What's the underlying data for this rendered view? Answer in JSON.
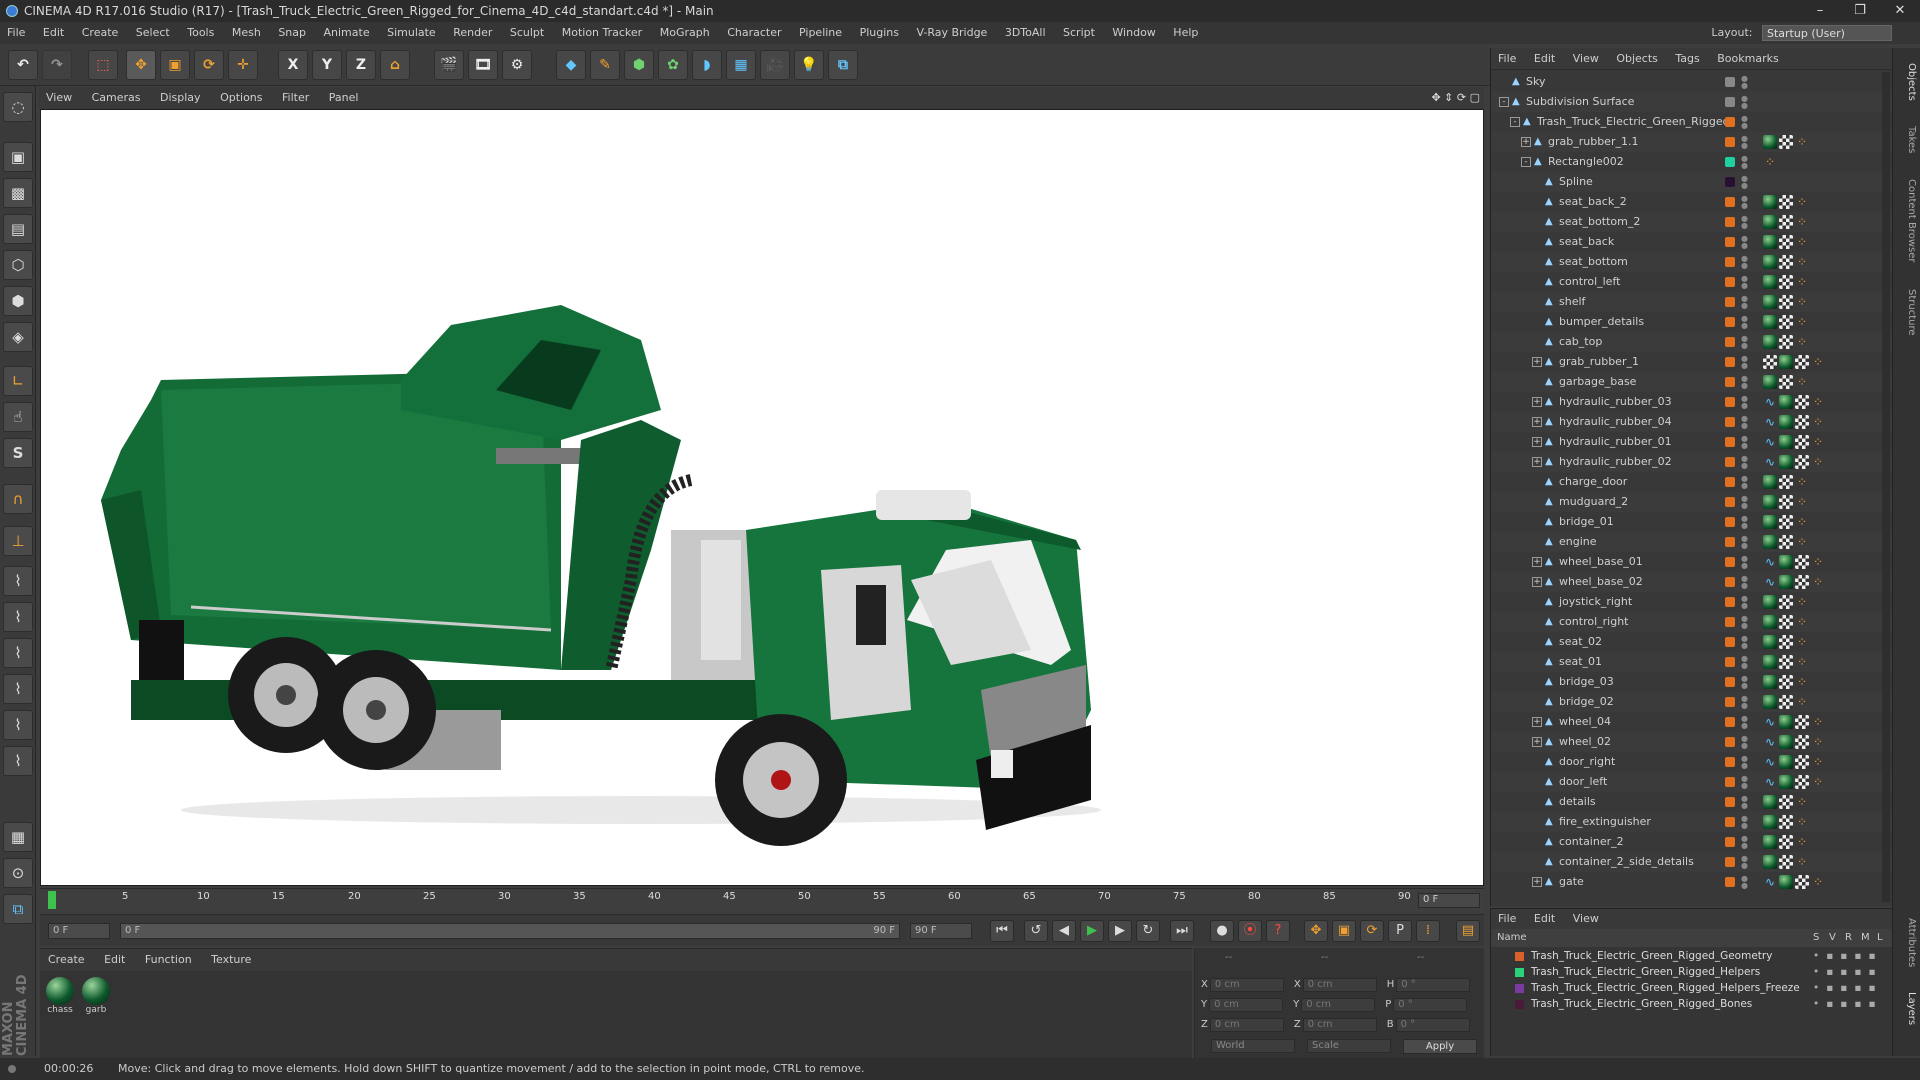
{
  "app": {
    "title": "CINEMA 4D R17.016 Studio (R17) - [Trash_Truck_Electric_Green_Rigged_for_Cinema_4D_c4d_standart.c4d *] - Main",
    "layout_label": "Layout:",
    "layout_value": "Startup (User)"
  },
  "window_controls": {
    "minimize": "–",
    "maximize": "❐",
    "close": "✕"
  },
  "menubar": [
    "File",
    "Edit",
    "Create",
    "Select",
    "Tools",
    "Mesh",
    "Snap",
    "Animate",
    "Simulate",
    "Render",
    "Sculpt",
    "Motion Tracker",
    "MoGraph",
    "Character",
    "Pipeline",
    "Plugins",
    "V-Ray Bridge",
    "3DToAll",
    "Script",
    "Window",
    "Help"
  ],
  "viewport_menu": [
    "View",
    "Cameras",
    "Display",
    "Options",
    "Filter",
    "Panel"
  ],
  "toolbar_axes": {
    "x": "X",
    "y": "Y",
    "z": "Z"
  },
  "timeline": {
    "ticks": [
      "0",
      "5",
      "10",
      "15",
      "20",
      "25",
      "30",
      "35",
      "40",
      "45",
      "50",
      "55",
      "60",
      "65",
      "70",
      "75",
      "80",
      "85",
      "90"
    ],
    "current_frame_right": "0 F",
    "start_frame": "0 F",
    "slider_start": "0 F",
    "slider_end": "90 F",
    "end_frame": "90 F",
    "marker_percent": 0
  },
  "material_menu": [
    "Create",
    "Edit",
    "Function",
    "Texture"
  ],
  "materials": [
    {
      "name": "chass"
    },
    {
      "name": "garb"
    }
  ],
  "coords": {
    "header_dashes": [
      "--",
      "--",
      "--"
    ],
    "rows": [
      {
        "axis": "X",
        "pos": "0 cm",
        "axis2": "X",
        "size": "0 cm",
        "axis3": "H",
        "rot": "0 °"
      },
      {
        "axis": "Y",
        "pos": "0 cm",
        "axis2": "Y",
        "size": "0 cm",
        "axis3": "P",
        "rot": "0 °"
      },
      {
        "axis": "Z",
        "pos": "0 cm",
        "axis2": "Z",
        "size": "0 cm",
        "axis3": "B",
        "rot": "0 °"
      }
    ],
    "mode1": "World",
    "mode2": "Scale",
    "apply": "Apply"
  },
  "status": {
    "time": "00:00:26",
    "message": "Move: Click and drag to move elements. Hold down SHIFT to quantize movement / add to the selection in point mode, CTRL to remove."
  },
  "object_menu": [
    "File",
    "Edit",
    "View",
    "Objects",
    "Tags",
    "Bookmarks"
  ],
  "objects": [
    {
      "name": "Sky",
      "depth": 0,
      "exp": "",
      "color": "#888888",
      "tags": []
    },
    {
      "name": "Subdivision Surface",
      "depth": 0,
      "exp": "-",
      "color": "#888888",
      "tags": []
    },
    {
      "name": "Trash_Truck_Electric_Green_Rigged",
      "depth": 1,
      "exp": "-",
      "color": "#e07020",
      "tags": []
    },
    {
      "name": "grab_rubber_1.1",
      "depth": 2,
      "exp": "+",
      "color": "#e07020",
      "tags": [
        "g",
        "c",
        "o"
      ]
    },
    {
      "name": "Rectangle002",
      "depth": 2,
      "exp": "-",
      "color": "#20d0a0",
      "tags": [
        "o"
      ]
    },
    {
      "name": "Spline",
      "depth": 3,
      "exp": "",
      "color": "#2a1030",
      "tags": []
    },
    {
      "name": "seat_back_2",
      "depth": 3,
      "exp": "",
      "color": "#e07020",
      "tags": [
        "g",
        "c",
        "o"
      ]
    },
    {
      "name": "seat_bottom_2",
      "depth": 3,
      "exp": "",
      "color": "#e07020",
      "tags": [
        "g",
        "c",
        "o"
      ]
    },
    {
      "name": "seat_back",
      "depth": 3,
      "exp": "",
      "color": "#e07020",
      "tags": [
        "g",
        "c",
        "o"
      ]
    },
    {
      "name": "seat_bottom",
      "depth": 3,
      "exp": "",
      "color": "#e07020",
      "tags": [
        "g",
        "c",
        "o"
      ]
    },
    {
      "name": "control_left",
      "depth": 3,
      "exp": "",
      "color": "#e07020",
      "tags": [
        "g",
        "c",
        "o"
      ]
    },
    {
      "name": "shelf",
      "depth": 3,
      "exp": "",
      "color": "#e07020",
      "tags": [
        "g",
        "c",
        "o"
      ]
    },
    {
      "name": "bumper_details",
      "depth": 3,
      "exp": "",
      "color": "#e07020",
      "tags": [
        "g",
        "c",
        "o"
      ]
    },
    {
      "name": "cab_top",
      "depth": 3,
      "exp": "",
      "color": "#e07020",
      "tags": [
        "g",
        "c",
        "o"
      ]
    },
    {
      "name": "grab_rubber_1",
      "depth": 3,
      "exp": "+",
      "color": "#e07020",
      "tags": [
        "c",
        "g",
        "c",
        "o"
      ]
    },
    {
      "name": "garbage_base",
      "depth": 3,
      "exp": "",
      "color": "#e07020",
      "tags": [
        "g",
        "c",
        "o"
      ]
    },
    {
      "name": "hydraulic_rubber_03",
      "depth": 3,
      "exp": "+",
      "color": "#e07020",
      "tags": [
        "s",
        "g",
        "c",
        "o"
      ]
    },
    {
      "name": "hydraulic_rubber_04",
      "depth": 3,
      "exp": "+",
      "color": "#e07020",
      "tags": [
        "s",
        "g",
        "c",
        "o"
      ]
    },
    {
      "name": "hydraulic_rubber_01",
      "depth": 3,
      "exp": "+",
      "color": "#e07020",
      "tags": [
        "s",
        "g",
        "c",
        "o"
      ]
    },
    {
      "name": "hydraulic_rubber_02",
      "depth": 3,
      "exp": "+",
      "color": "#e07020",
      "tags": [
        "s",
        "g",
        "c",
        "o"
      ]
    },
    {
      "name": "charge_door",
      "depth": 3,
      "exp": "",
      "color": "#e07020",
      "tags": [
        "g",
        "c",
        "o"
      ]
    },
    {
      "name": "mudguard_2",
      "depth": 3,
      "exp": "",
      "color": "#e07020",
      "tags": [
        "g",
        "c",
        "o"
      ]
    },
    {
      "name": "bridge_01",
      "depth": 3,
      "exp": "",
      "color": "#e07020",
      "tags": [
        "g",
        "c",
        "o"
      ]
    },
    {
      "name": "engine",
      "depth": 3,
      "exp": "",
      "color": "#e07020",
      "tags": [
        "g",
        "c",
        "o"
      ]
    },
    {
      "name": "wheel_base_01",
      "depth": 3,
      "exp": "+",
      "color": "#e07020",
      "tags": [
        "s",
        "g",
        "c",
        "o"
      ]
    },
    {
      "name": "wheel_base_02",
      "depth": 3,
      "exp": "+",
      "color": "#e07020",
      "tags": [
        "s",
        "g",
        "c",
        "o"
      ]
    },
    {
      "name": "joystick_right",
      "depth": 3,
      "exp": "",
      "color": "#e07020",
      "tags": [
        "g",
        "c",
        "o"
      ]
    },
    {
      "name": "control_right",
      "depth": 3,
      "exp": "",
      "color": "#e07020",
      "tags": [
        "g",
        "c",
        "o"
      ]
    },
    {
      "name": "seat_02",
      "depth": 3,
      "exp": "",
      "color": "#e07020",
      "tags": [
        "g",
        "c",
        "o"
      ]
    },
    {
      "name": "seat_01",
      "depth": 3,
      "exp": "",
      "color": "#e07020",
      "tags": [
        "g",
        "c",
        "o"
      ]
    },
    {
      "name": "bridge_03",
      "depth": 3,
      "exp": "",
      "color": "#e07020",
      "tags": [
        "g",
        "c",
        "o"
      ]
    },
    {
      "name": "bridge_02",
      "depth": 3,
      "exp": "",
      "color": "#e07020",
      "tags": [
        "g",
        "c",
        "o"
      ]
    },
    {
      "name": "wheel_04",
      "depth": 3,
      "exp": "+",
      "color": "#e07020",
      "tags": [
        "s",
        "g",
        "c",
        "o"
      ]
    },
    {
      "name": "wheel_02",
      "depth": 3,
      "exp": "+",
      "color": "#e07020",
      "tags": [
        "s",
        "g",
        "c",
        "o"
      ]
    },
    {
      "name": "door_right",
      "depth": 3,
      "exp": "",
      "color": "#e07020",
      "tags": [
        "s",
        "g",
        "c",
        "o"
      ]
    },
    {
      "name": "door_left",
      "depth": 3,
      "exp": "",
      "color": "#e07020",
      "tags": [
        "s",
        "g",
        "c",
        "o"
      ]
    },
    {
      "name": "details",
      "depth": 3,
      "exp": "",
      "color": "#e07020",
      "tags": [
        "g",
        "c",
        "o"
      ]
    },
    {
      "name": "fire_extinguisher",
      "depth": 3,
      "exp": "",
      "color": "#e07020",
      "tags": [
        "g",
        "c",
        "o"
      ]
    },
    {
      "name": "container_2",
      "depth": 3,
      "exp": "",
      "color": "#e07020",
      "tags": [
        "g",
        "c",
        "o"
      ]
    },
    {
      "name": "container_2_side_details",
      "depth": 3,
      "exp": "",
      "color": "#e07020",
      "tags": [
        "g",
        "c",
        "o"
      ]
    },
    {
      "name": "gate",
      "depth": 3,
      "exp": "+",
      "color": "#e07020",
      "tags": [
        "s",
        "g",
        "c",
        "o"
      ]
    }
  ],
  "layer_menu": [
    "File",
    "Edit",
    "View"
  ],
  "layer_header": {
    "name": "Name",
    "cols": [
      "S",
      "V",
      "R",
      "M",
      "L"
    ]
  },
  "layers": [
    {
      "name": "Trash_Truck_Electric_Green_Rigged_Geometry",
      "color": "#d9602a"
    },
    {
      "name": "Trash_Truck_Electric_Green_Rigged_Helpers",
      "color": "#2ad37a"
    },
    {
      "name": "Trash_Truck_Electric_Green_Rigged_Helpers_Freeze",
      "color": "#7a3aa0"
    },
    {
      "name": "Trash_Truck_Electric_Green_Rigged_Bones",
      "color": "#4a1a3a"
    }
  ],
  "right_tabs": [
    "Objects",
    "Takes",
    "Content Browser",
    "Structure",
    "Attributes",
    "Layers"
  ],
  "brand": "MAXON CINEMA 4D"
}
